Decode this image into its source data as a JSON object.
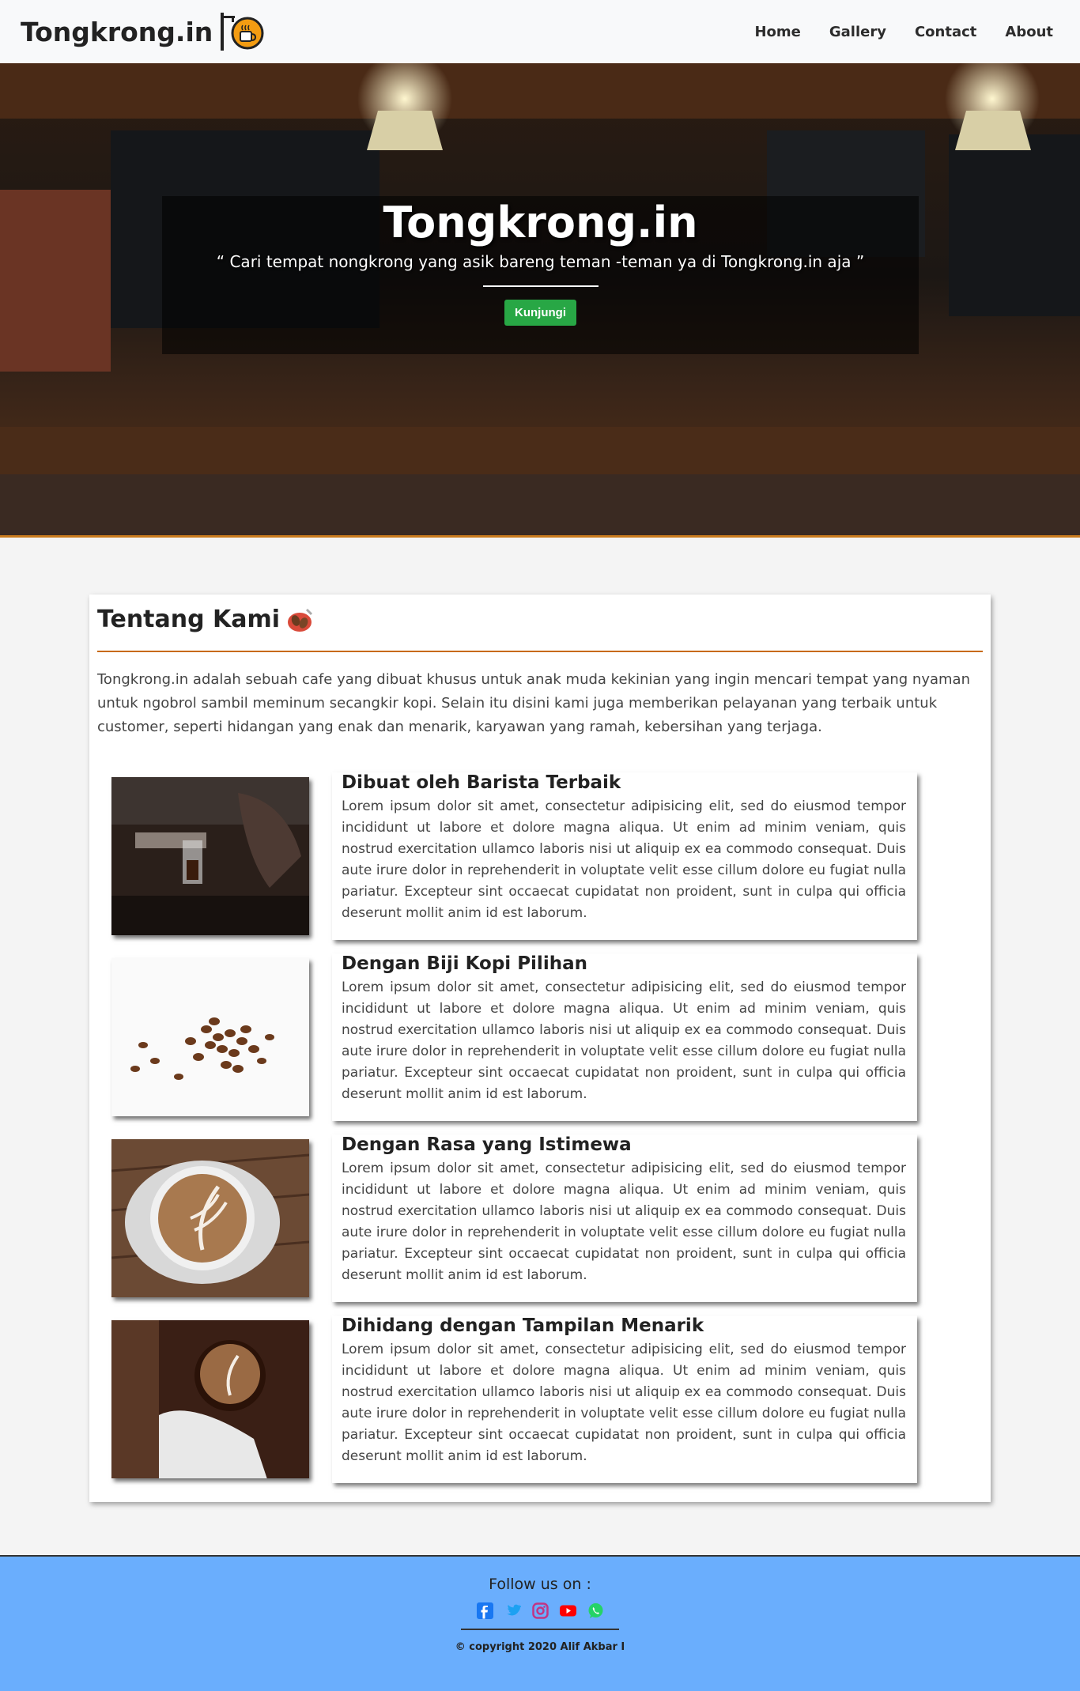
{
  "nav": {
    "brand": "Tongkrong.in",
    "links": [
      "Home",
      "Gallery",
      "Contact",
      "About"
    ]
  },
  "hero": {
    "title": "Tongkrong.in",
    "subtitle": "“ Cari tempat nongkrong yang asik bareng teman -teman ya di Tongkrong.in aja ”",
    "button": "Kunjungi"
  },
  "about": {
    "title": "Tentang Kami",
    "description": "Tongkrong.in adalah sebuah cafe yang dibuat khusus untuk anak muda kekinian yang ingin mencari tempat yang nyaman untuk ngobrol sambil meminum secangkir kopi. Selain itu disini kami juga memberikan pelayanan yang terbaik untuk customer, seperti hidangan yang enak dan menarik, karyawan yang ramah, kebersihan yang terjaga.",
    "features": [
      {
        "title": "Dibuat oleh Barista Terbaik",
        "text": "Lorem ipsum dolor sit amet, consectetur adipisicing elit, sed do eiusmod tempor incididunt ut labore et dolore magna aliqua. Ut enim ad minim veniam, quis nostrud exercitation ullamco laboris nisi ut aliquip ex ea commodo consequat. Duis aute irure dolor in reprehenderit in voluptate velit esse cillum dolore eu fugiat nulla pariatur. Excepteur sint occaecat cupidatat non proident, sunt in culpa qui officia deserunt mollit anim id est laborum."
      },
      {
        "title": "Dengan Biji Kopi Pilihan",
        "text": "Lorem ipsum dolor sit amet, consectetur adipisicing elit, sed do eiusmod tempor incididunt ut labore et dolore magna aliqua. Ut enim ad minim veniam, quis nostrud exercitation ullamco laboris nisi ut aliquip ex ea commodo consequat. Duis aute irure dolor in reprehenderit in voluptate velit esse cillum dolore eu fugiat nulla pariatur. Excepteur sint occaecat cupidatat non proident, sunt in culpa qui officia deserunt mollit anim id est laborum."
      },
      {
        "title": "Dengan Rasa yang Istimewa",
        "text": "Lorem ipsum dolor sit amet, consectetur adipisicing elit, sed do eiusmod tempor incididunt ut labore et dolore magna aliqua. Ut enim ad minim veniam, quis nostrud exercitation ullamco laboris nisi ut aliquip ex ea commodo consequat. Duis aute irure dolor in reprehenderit in voluptate velit esse cillum dolore eu fugiat nulla pariatur. Excepteur sint occaecat cupidatat non proident, sunt in culpa qui officia deserunt mollit anim id est laborum."
      },
      {
        "title": "Dihidang dengan Tampilan Menarik",
        "text": "Lorem ipsum dolor sit amet, consectetur adipisicing elit, sed do eiusmod tempor incididunt ut labore et dolore magna aliqua. Ut enim ad minim veniam, quis nostrud exercitation ullamco laboris nisi ut aliquip ex ea commodo consequat. Duis aute irure dolor in reprehenderit in voluptate velit esse cillum dolore eu fugiat nulla pariatur. Excepteur sint occaecat cupidatat non proident, sunt in culpa qui officia deserunt mollit anim id est laborum."
      }
    ]
  },
  "footer": {
    "follow": "Follow us on :",
    "icons": [
      "facebook-icon",
      "twitter-icon",
      "instagram-icon",
      "youtube-icon",
      "whatsapp-icon"
    ],
    "copyright": "© copyright 2020 Alif Akbar I"
  }
}
